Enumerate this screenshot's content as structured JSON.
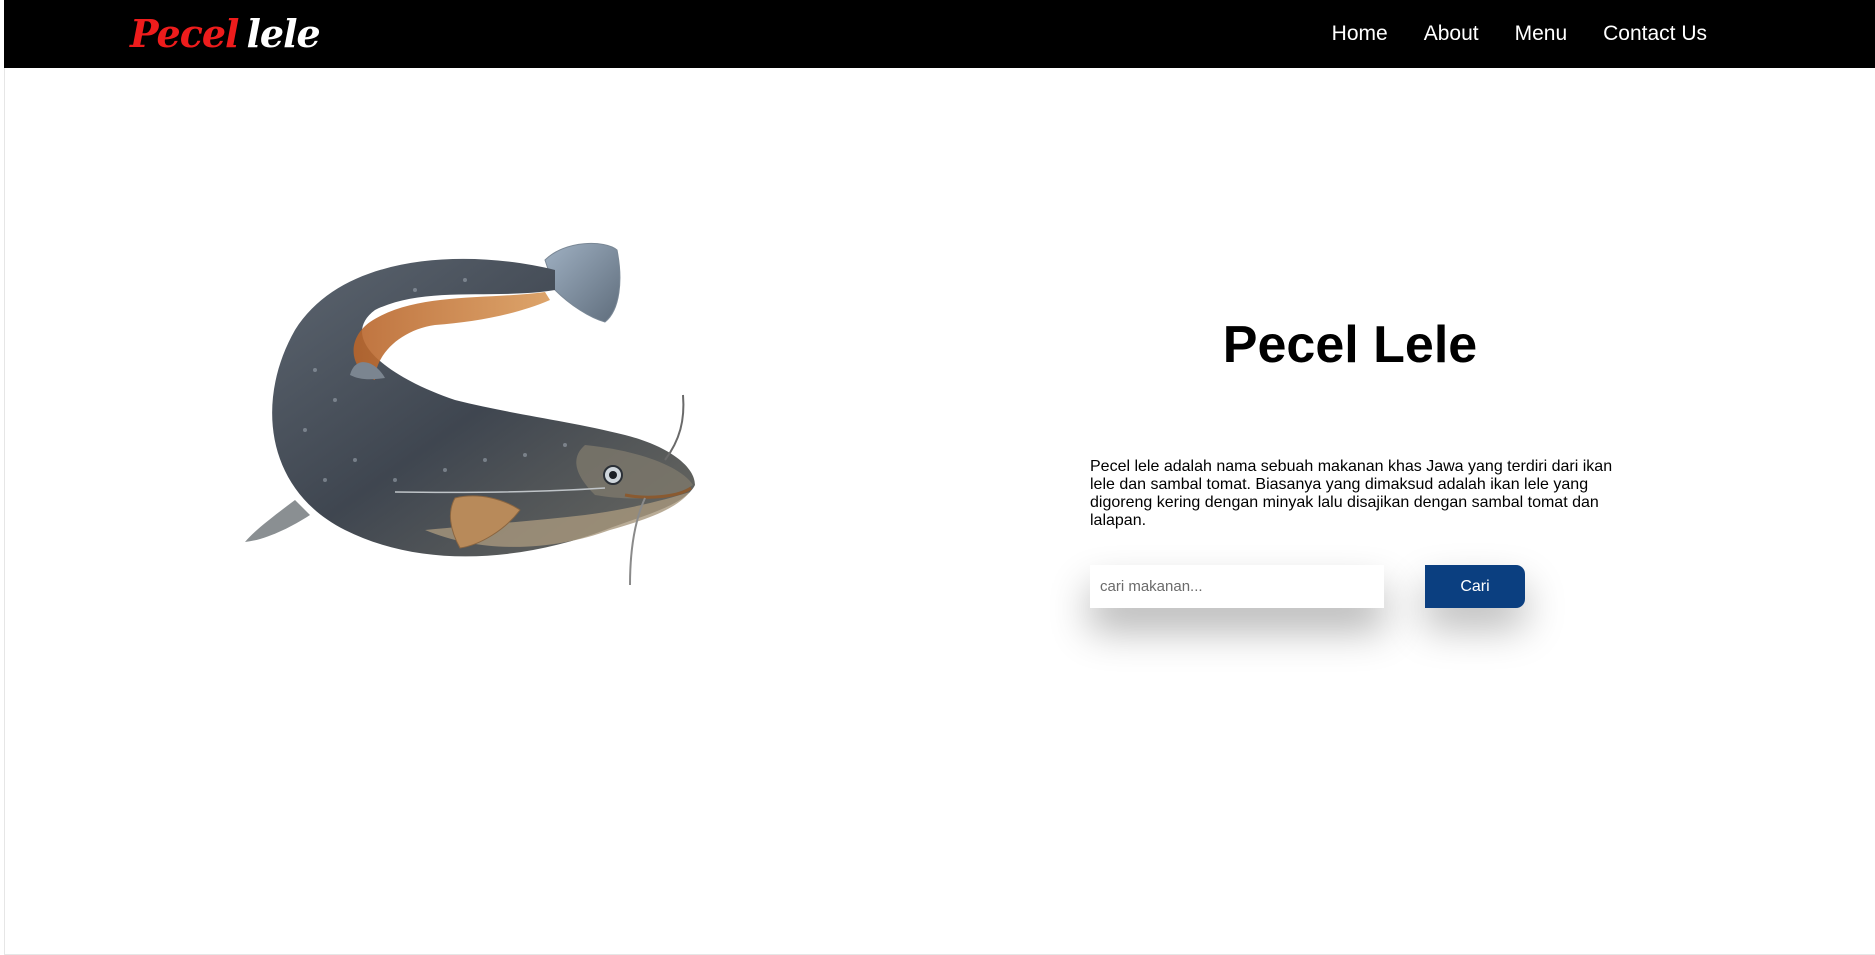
{
  "brand": {
    "logo_part1": "Pecel",
    "logo_part2": "lele",
    "logo_color_primary": "#ee1c1c",
    "logo_color_secondary": "#ffffff"
  },
  "nav": {
    "items": [
      {
        "label": "Home"
      },
      {
        "label": "About"
      },
      {
        "label": "Menu"
      },
      {
        "label": "Contact Us"
      }
    ]
  },
  "hero": {
    "image_icon": "catfish-illustration",
    "title": "Pecel Lele",
    "description": "Pecel lele adalah nama sebuah makanan khas Jawa yang terdiri dari ikan lele dan sambal tomat. Biasanya yang dimaksud adalah ikan lele yang digoreng kering dengan minyak lalu disajikan dengan sambal tomat dan lalapan."
  },
  "search": {
    "placeholder": "cari makanan...",
    "value": "",
    "button_label": "Cari",
    "button_color": "#0b3f80"
  }
}
